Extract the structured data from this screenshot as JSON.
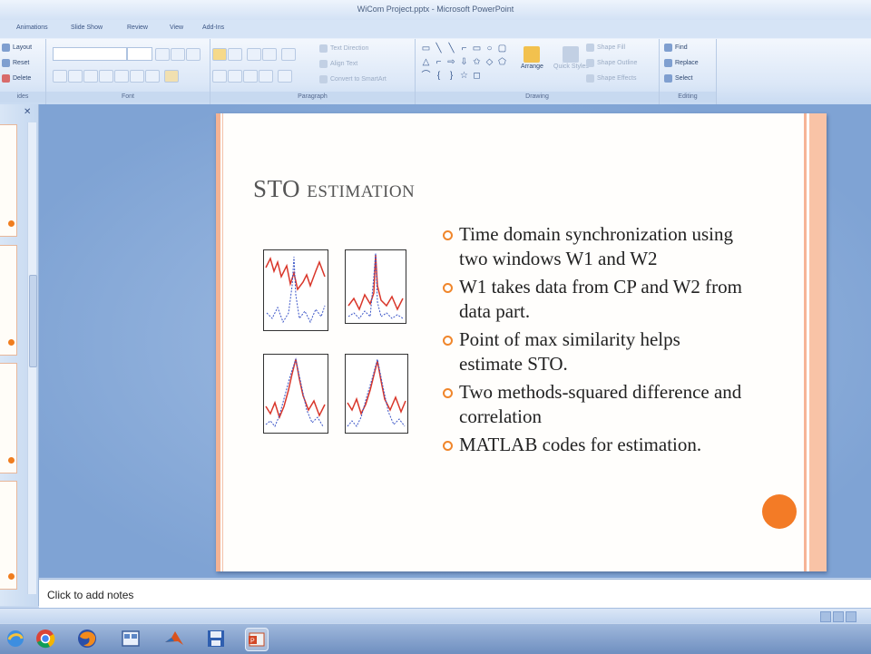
{
  "window": {
    "title": "WiCom Project.pptx - Microsoft PowerPoint"
  },
  "tabs": [
    "Animations",
    "Slide Show",
    "Review",
    "View",
    "Add-Ins"
  ],
  "ribbon": {
    "slides": {
      "layout": "Layout",
      "reset": "Reset",
      "delete": "Delete",
      "label": "ides"
    },
    "font": {
      "label": "Font"
    },
    "paragraph": {
      "text_direction": "Text Direction",
      "align_text": "Align Text",
      "convert_smartart": "Convert to SmartArt",
      "label": "Paragraph"
    },
    "drawing": {
      "arrange": "Arrange",
      "quick_styles": "Quick Styles",
      "shape_fill": "Shape Fill",
      "shape_outline": "Shape Outline",
      "shape_effects": "Shape Effects",
      "label": "Drawing"
    },
    "editing": {
      "find": "Find",
      "replace": "Replace",
      "select": "Select",
      "label": "Editing"
    }
  },
  "slide": {
    "title": "STO estimation",
    "bullets": [
      "Time domain synchronization using two windows W1 and W2",
      "W1 takes data from CP and W2 from data part.",
      "Point of max similarity helps estimate STO.",
      "Two methods-squared difference and correlation",
      "MATLAB codes for estimation."
    ],
    "accent_color": "#f37b26"
  },
  "notes": {
    "placeholder": "Click to add notes"
  },
  "taskbar": {
    "icons": [
      "ie-icon",
      "chrome-icon",
      "firefox-icon",
      "window-icon",
      "matlab-icon",
      "save-icon",
      "powerpoint-icon"
    ]
  }
}
